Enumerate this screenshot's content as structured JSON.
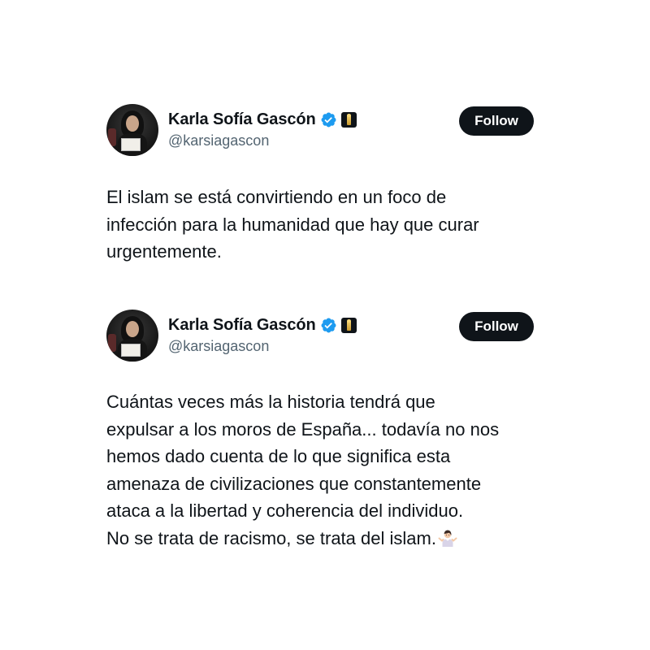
{
  "tweets": [
    {
      "author": {
        "display_name": "Karla Sofía Gascón",
        "handle": "@karsiagascon",
        "avatar_icon": "profile-photo",
        "verified_icon": "verified-badge-icon",
        "affiliate_icon": "oscar-statuette-icon"
      },
      "follow_label": "Follow",
      "text_lines": [
        "El islam se está convirtiendo en un foco de",
        "infección para la humanidad que hay que curar",
        "urgentemente."
      ]
    },
    {
      "author": {
        "display_name": "Karla Sofía Gascón",
        "handle": "@karsiagascon",
        "avatar_icon": "profile-photo",
        "verified_icon": "verified-badge-icon",
        "affiliate_icon": "oscar-statuette-icon"
      },
      "follow_label": "Follow",
      "text_lines": [
        "Cuántas veces más la historia tendrá que",
        "expulsar a los moros de España... todavía no nos",
        "hemos dado cuenta de lo que significa esta",
        "amenaza de civilizaciones que constantemente",
        "ataca a la libertad y coherencia del individuo.",
        "No se trata de racismo, se trata del islam."
      ],
      "trailing_emoji": "person-shrugging-emoji"
    }
  ],
  "colors": {
    "text": "#0f1419",
    "secondary_text": "#536471",
    "follow_bg": "#0f1419",
    "follow_text": "#ffffff",
    "verified_blue": "#1d9bf0",
    "background": "#ffffff"
  }
}
